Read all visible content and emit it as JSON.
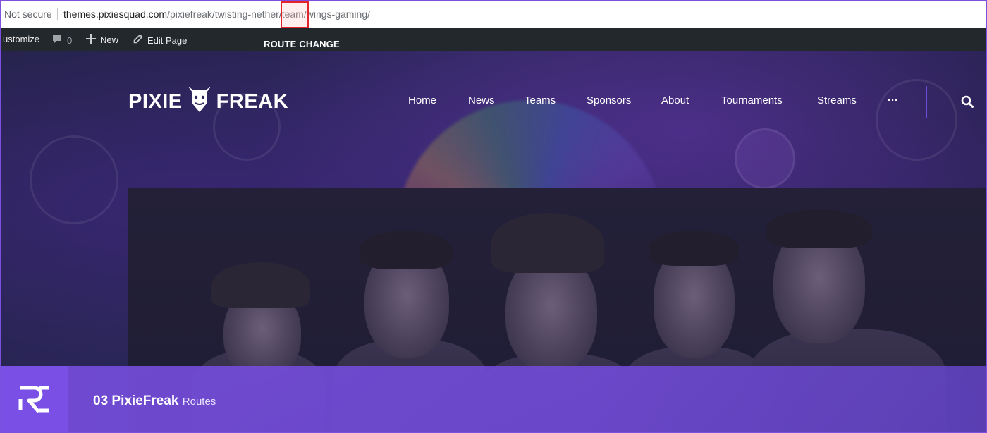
{
  "browser": {
    "security": "Not secure",
    "url_host": "themes.pixiesquad.com",
    "url_path_before": "/pixiefreak/twisting-nether/",
    "url_highlight": "team",
    "url_path_after": "/wings-gaming/"
  },
  "admin_bar": {
    "customize": "ustomize",
    "comments_count": "0",
    "new_label": "New",
    "edit_label": "Edit Page"
  },
  "annotation": {
    "label": "ROUTE CHANGE",
    "highlight_color": "#e3242b"
  },
  "site": {
    "logo_left": "PIXIE",
    "logo_right": "FREAK",
    "nav": [
      "Home",
      "News",
      "Teams",
      "Sponsors",
      "About",
      "Tournaments",
      "Streams",
      "···"
    ],
    "accent_color": "#7a4fe6"
  },
  "footer": {
    "title": "03 PixieFreak",
    "subtitle": "Routes"
  },
  "icons": [
    "comment-icon",
    "plus-icon",
    "pencil-icon",
    "bull-mascot-icon",
    "search-icon",
    "rs-logo-icon"
  ]
}
